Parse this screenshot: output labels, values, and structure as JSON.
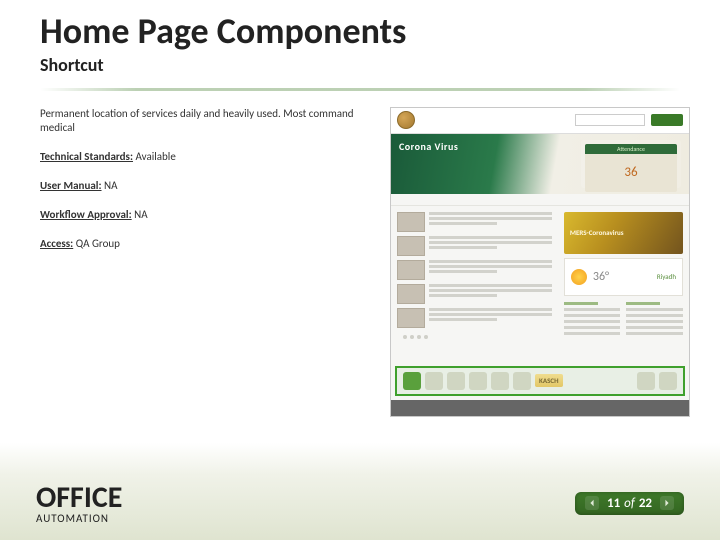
{
  "title": "Home Page Components",
  "subtitle": "Shortcut",
  "description": "Permanent location of services daily and heavily used. Most command medical",
  "fields": {
    "tech_std": {
      "label": "Technical Standards:",
      "value": " Available"
    },
    "user_manual": {
      "label": "User Manual:",
      "value": " NA"
    },
    "workflow": {
      "label": "Workflow Approval:",
      "value": " NA"
    },
    "access": {
      "label": "Access:",
      "value": " QA Group"
    }
  },
  "screenshot": {
    "banner_title": "Corona Virus",
    "attendance_label": "Attendance",
    "attendance_value": "36",
    "mers_label": "MERS-Coronavirus",
    "city": "Riyadh",
    "temp": "36°",
    "kasch_label": "KASCH"
  },
  "brand": {
    "main": "OFFICE",
    "sub": "AUTOMATION"
  },
  "pager": {
    "current": "11",
    "of": "of",
    "total": "22"
  }
}
